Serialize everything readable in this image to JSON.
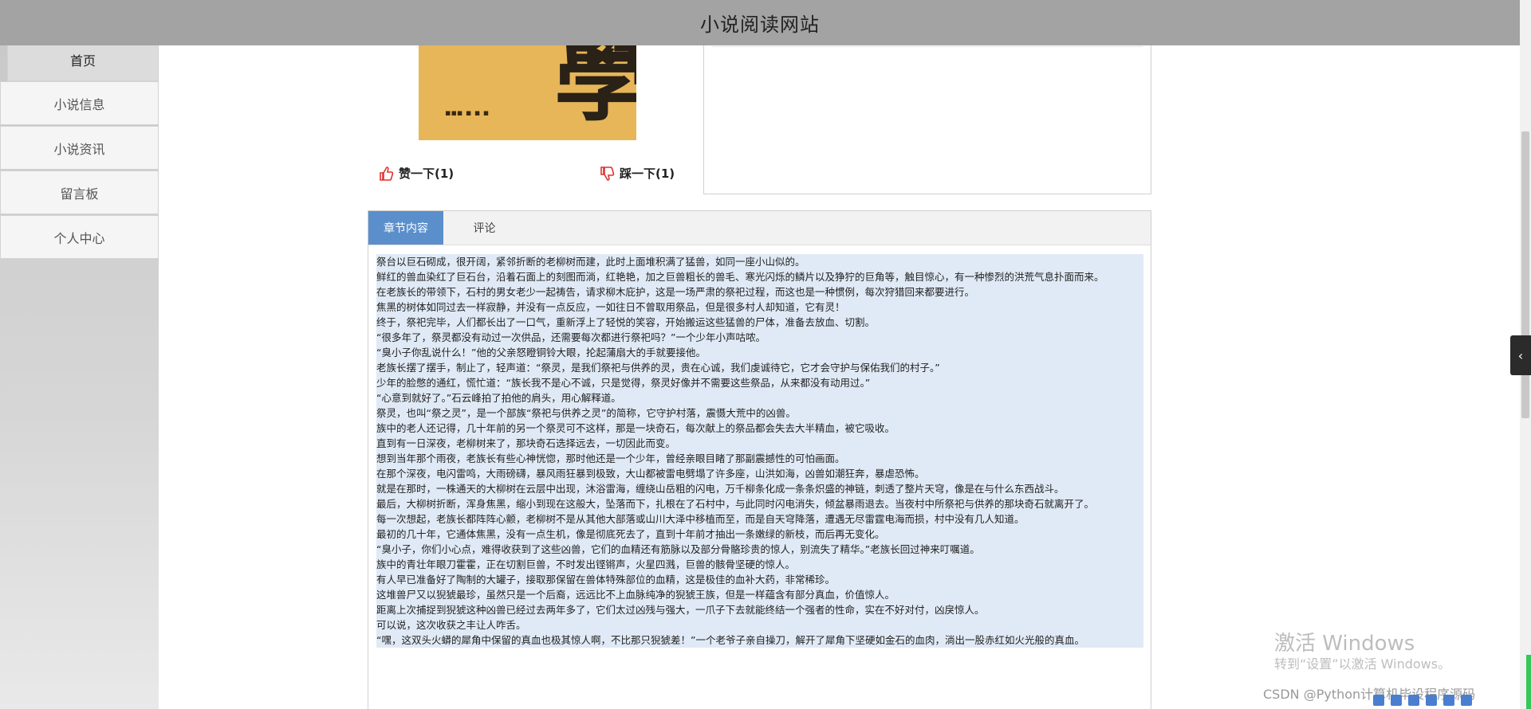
{
  "site": {
    "title": "小说阅读网站"
  },
  "nav": {
    "items": [
      {
        "label": "首页"
      },
      {
        "label": "小说信息"
      },
      {
        "label": "小说资讯"
      },
      {
        "label": "留言板"
      },
      {
        "label": "个人中心"
      }
    ]
  },
  "book": {
    "like_label": "赞一下(1)",
    "dislike_label": "踩一下(1)"
  },
  "tabs": {
    "chapter": "章节内容",
    "comments": "评论"
  },
  "chapter_paragraphs": [
    "祭台以巨石砌成，很开阔，紧邻折断的老柳树而建，此时上面堆积满了猛兽，如同一座小山似的。",
    "鲜红的兽血染红了巨石台，沿着石面上的刻图而淌，红艳艳，加之巨兽粗长的兽毛、寒光闪烁的鳞片以及狰狞的巨角等，触目惊心，有一种惨烈的洪荒气息扑面而来。",
    "在老族长的带领下，石村的男女老少一起祷告，请求柳木庇护，这是一场严肃的祭祀过程，而这也是一种惯例，每次狩猎回来都要进行。",
    "焦黑的树体如同过去一样寂静，并没有一点反应，一如往日不曾取用祭品，但是很多村人却知道，它有灵！",
    "终于，祭祀完毕，人们都长出了一口气，重新浮上了轻悦的笑容，开始搬运这些猛兽的尸体，准备去放血、切割。",
    "“很多年了，祭灵都没有动过一次供品，还需要每次都进行祭祀吗？”一个少年小声咕哝。",
    "“臭小子你乱说什么！”他的父亲怒瞪铜铃大眼，抡起蒲扇大的手就要接他。",
    "老族长摆了摆手，制止了，轻声道：“祭灵，是我们祭祀与供养的灵，贵在心诚，我们虔诚待它，它才会守护与保佑我们的村子。”",
    "少年的脸憋的通红，慌忙道：“族长我不是心不诚，只是觉得，祭灵好像并不需要这些祭品，从来都没有动用过。”",
    "“心意到就好了。”石云峰拍了拍他的肩头，用心解释道。",
    "祭灵，也叫“祭之灵”，是一个部族“祭祀与供养之灵”的简称，它守护村落，震慑大荒中的凶兽。",
    "族中的老人还记得，几十年前的另一个祭灵可不这样，那是一块奇石，每次献上的祭品都会失去大半精血，被它吸收。",
    "直到有一日深夜，老柳树来了，那块奇石选择远去，一切因此而变。",
    "想到当年那个雨夜，老族长有些心神恍惚，那时他还是一个少年，曾经亲眼目睹了那副震撼性的可怕画面。",
    "在那个深夜，电闪雷鸣，大雨磅礴，暴风雨狂暴到极致，大山都被雷电劈塌了许多座，山洪如海，凶兽如潮狂奔，暴虐恐怖。",
    "就是在那时，一株通天的大柳树在云层中出现，沐浴雷海，缠绕山岳粗的闪电，万千柳条化成一条条炽盛的神链，刺透了整片天穹，像是在与什么东西战斗。",
    "最后，大柳树折断，浑身焦黑，缩小到现在这般大，坠落而下，扎根在了石村中，与此同时闪电消失，倾盆暴雨退去。当夜村中所祭祀与供养的那块奇石就离开了。",
    "每一次想起，老族长都阵阵心颤，老柳树不是从其他大部落或山川大泽中移植而至，而是自天穹降落，遭遇无尽雷霆电海而损，村中没有几人知道。",
    "最初的几十年，它通体焦黑，没有一点生机，像是彻底死去了，直到十年前才抽出一条嫩绿的新枝，而后再无变化。",
    "“臭小子，你们小心点，难得收获到了这些凶兽，它们的血精还有筋脉以及部分骨骼珍贵的惊人，别流失了精华。”老族长回过神来叮嘱道。",
    "族中的青壮年眼刀霍霍，正在切割巨兽，不时发出铿锵声，火星四溅，巨兽的骸骨坚硬的惊人。",
    "有人早已准备好了陶制的大罐子，接取那保留在兽体特殊部位的血精，这是极佳的血补大药，非常稀珍。",
    "这堆兽尸又以猊猇最珍，虽然只是一个后裔，远远比不上血脉纯净的猊猇王族，但是一样蕴含有部分真血，价值惊人。",
    "距离上次捕捉到猊猇这种凶兽已经过去两年多了，它们太过凶残与强大，一爪子下去就能终结一个强者的性命，实在不好对付，凶戾惊人。",
    "可以说，这次收获之丰让人咋舌。",
    "“嘿，这双头火蟒的犀角中保留的真血也极其惊人啊，不比那只猊猇差！”一个老爷子亲自操刀，解开了犀角下坚硬如金石的血肉，淌出一股赤红如火光般的真血。"
  ],
  "os": {
    "activate_title": "激活 Windows",
    "activate_sub": "转到“设置”以激活 Windows。",
    "csdn_credit": "CSDN @Python计算机毕设程序源码"
  }
}
